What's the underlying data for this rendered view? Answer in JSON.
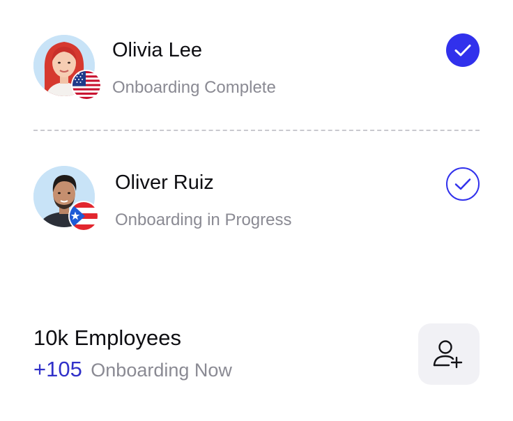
{
  "employees": [
    {
      "name": "Olivia Lee",
      "status": "Onboarding Complete",
      "flag_icon": "us-flag-icon",
      "check_state": "complete"
    },
    {
      "name": "Oliver Ruiz",
      "status": "Onboarding in Progress",
      "flag_icon": "puerto-rico-flag-icon",
      "check_state": "in-progress"
    }
  ],
  "summary": {
    "title": "10k Employees",
    "count": "+105",
    "label": "Onboarding Now"
  },
  "add_button": {
    "icon": "add-user-icon"
  },
  "colors": {
    "accent": "#3131ec",
    "count_text": "#3131c9",
    "secondary_text": "#8a8a93",
    "button_bg": "#f1f1f5",
    "divider": "#c9c9ce"
  }
}
